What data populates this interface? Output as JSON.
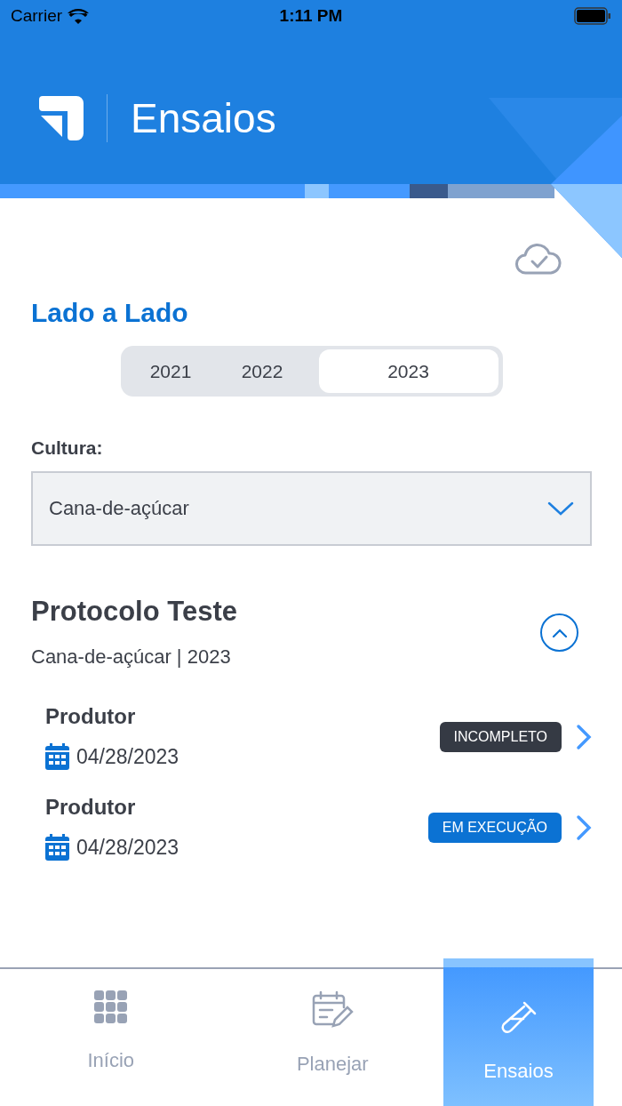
{
  "status_bar": {
    "carrier": "Carrier",
    "time": "1:11 PM"
  },
  "header": {
    "title": "Ensaios"
  },
  "section_title": "Lado a Lado",
  "years": [
    {
      "label": "2021",
      "selected": false
    },
    {
      "label": "2022",
      "selected": false
    },
    {
      "label": "2023",
      "selected": true
    }
  ],
  "culture": {
    "label": "Cultura:",
    "value": "Cana-de-açúcar"
  },
  "protocol": {
    "title": "Protocolo Teste",
    "subtitle": "Cana-de-açúcar | 2023",
    "expanded": true,
    "items": [
      {
        "name": "Produtor",
        "date": "04/28/2023",
        "status": "INCOMPLETO",
        "kind": "incomplete"
      },
      {
        "name": "Produtor",
        "date": "04/28/2023",
        "status": "EM EXECUÇÃO",
        "kind": "running"
      }
    ]
  },
  "tab_bar": [
    {
      "label": "Início",
      "selected": false
    },
    {
      "label": "Planejar",
      "selected": false
    },
    {
      "label": "Ensaios",
      "selected": true
    }
  ]
}
